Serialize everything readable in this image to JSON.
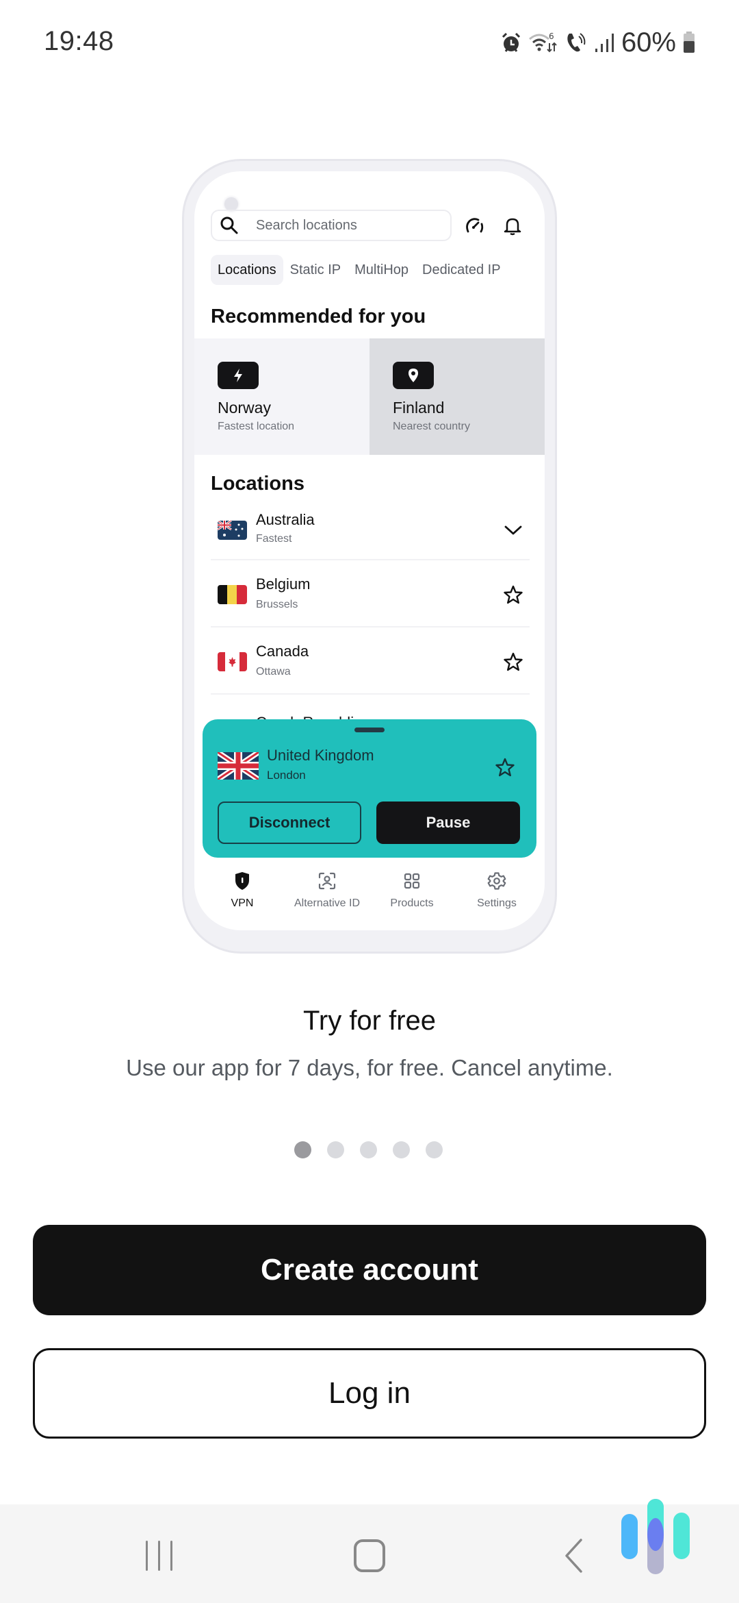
{
  "status_bar": {
    "time": "19:48",
    "battery_percent": "60%",
    "icons": [
      "alarm-icon",
      "wifi-6-icon",
      "wifi-calling-icon",
      "signal-icon",
      "battery-icon"
    ]
  },
  "phone_preview": {
    "search": {
      "placeholder": "Search locations"
    },
    "top_icons": [
      "speedometer-icon",
      "bell-icon"
    ],
    "tabs": [
      {
        "label": "Locations",
        "active": true
      },
      {
        "label": "Static IP",
        "active": false
      },
      {
        "label": "MultiHop",
        "active": false
      },
      {
        "label": "Dedicated IP",
        "active": false
      }
    ],
    "recommended": {
      "title": "Recommended for you",
      "cards": [
        {
          "icon": "lightning-icon",
          "name": "Norway",
          "subtitle": "Fastest location"
        },
        {
          "icon": "location-pin-icon",
          "name": "Finland",
          "subtitle": "Nearest country"
        }
      ]
    },
    "locations": {
      "title": "Locations",
      "items": [
        {
          "name": "Australia",
          "subtitle": "Fastest",
          "flag": "australia",
          "action": "chevron-down-icon"
        },
        {
          "name": "Belgium",
          "subtitle": "Brussels",
          "flag": "belgium",
          "action": "star-icon"
        },
        {
          "name": "Canada",
          "subtitle": "Ottawa",
          "flag": "canada",
          "action": "star-icon"
        }
      ],
      "partial_item": "Czech Republic"
    },
    "connection": {
      "country": "United Kingdom",
      "city": "London",
      "disconnect_label": "Disconnect",
      "pause_label": "Pause",
      "accent_color": "#20bfbb"
    },
    "bottom_nav": [
      {
        "label": "VPN",
        "icon": "shield-icon",
        "active": true
      },
      {
        "label": "Alternative ID",
        "icon": "face-scan-icon",
        "active": false
      },
      {
        "label": "Products",
        "icon": "grid-icon",
        "active": false
      },
      {
        "label": "Settings",
        "icon": "gear-icon",
        "active": false
      }
    ]
  },
  "onboarding": {
    "headline": "Try for free",
    "subline": "Use our app for 7 days, for free. Cancel anytime.",
    "page_indicator": {
      "current": 1,
      "total": 5
    }
  },
  "actions": {
    "create_account": "Create account",
    "log_in": "Log in"
  },
  "system_nav": [
    "recent-apps-icon",
    "home-icon",
    "back-icon"
  ]
}
